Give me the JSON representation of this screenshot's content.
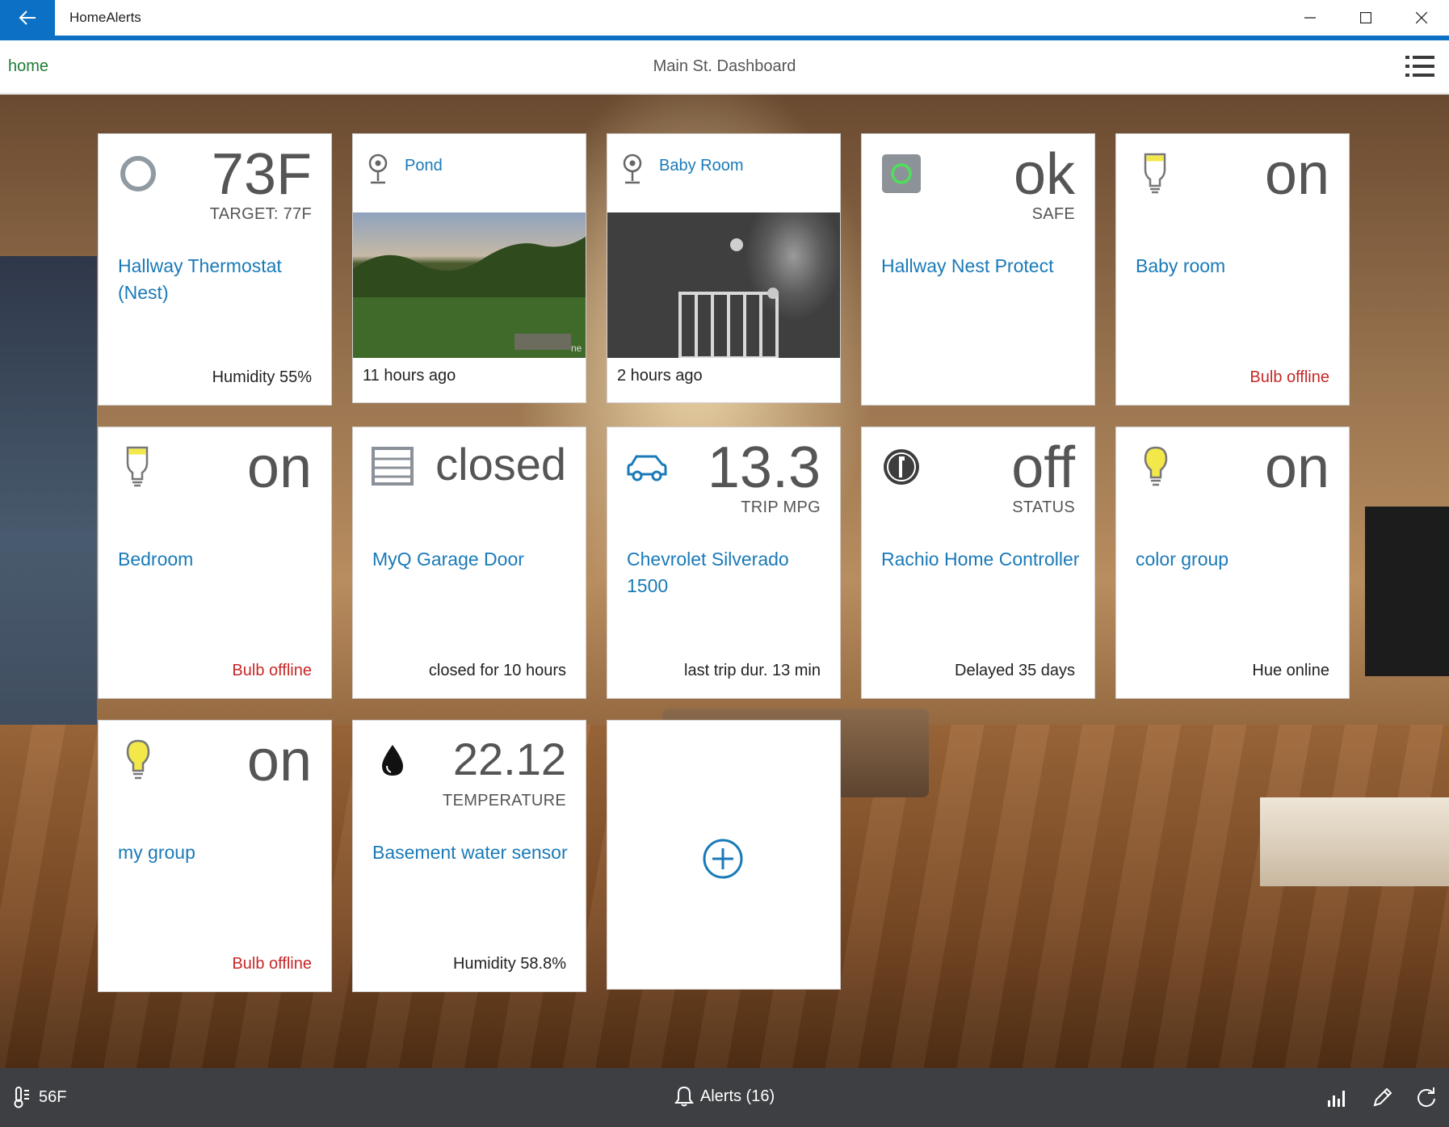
{
  "window": {
    "title": "HomeAlerts"
  },
  "header": {
    "home_link": "home",
    "title": "Main St. Dashboard"
  },
  "tiles": {
    "thermostat": {
      "value": "73F",
      "sub": "TARGET: 77F",
      "name": "Hallway Thermostat (Nest)",
      "footer": "Humidity 55%",
      "icon": "nest-ring-icon"
    },
    "pond": {
      "label": "Pond",
      "time": "11 hours ago",
      "icon": "camera-icon",
      "watermark": "ne"
    },
    "baby_cam": {
      "label": "Baby Room",
      "time": "2 hours ago",
      "icon": "camera-icon"
    },
    "nest_protect": {
      "value": "ok",
      "sub": "SAFE",
      "name": "Hallway Nest Protect",
      "icon": "smoke-detector-icon"
    },
    "baby_room_bulb": {
      "value": "on",
      "name": "Baby room",
      "footer": "Bulb offline",
      "icon": "bulb-icon"
    },
    "bedroom": {
      "value": "on",
      "name": "Bedroom",
      "footer": "Bulb offline",
      "icon": "bulb-icon"
    },
    "garage": {
      "value": "closed",
      "name": "MyQ Garage Door",
      "footer": "closed for 10 hours",
      "icon": "garage-icon"
    },
    "car": {
      "value": "13.3",
      "sub": "TRIP MPG",
      "name": "Chevrolet Silverado 1500",
      "footer": "last trip dur. 13 min",
      "icon": "car-icon"
    },
    "rachio": {
      "value": "off",
      "sub": "STATUS",
      "name": "Rachio Home Controller",
      "footer": "Delayed 35 days",
      "icon": "rachio-icon"
    },
    "color_group": {
      "value": "on",
      "name": "color group",
      "footer": "Hue online",
      "icon": "bulb-icon"
    },
    "my_group": {
      "value": "on",
      "name": "my group",
      "footer": "Bulb offline",
      "icon": "bulb-icon"
    },
    "water_sensor": {
      "value": "22.12",
      "sub": "TEMPERATURE",
      "name": "Basement water sensor",
      "footer": "Humidity 58.8%",
      "icon": "water-drop-icon"
    }
  },
  "statusbar": {
    "temperature": "56F",
    "alerts": "Alerts (16)"
  },
  "colors": {
    "accent": "#0c71c4",
    "link": "#1a7ab8",
    "error": "#c62828",
    "home": "#1e7b34",
    "bulb_on": "#f3e84a"
  }
}
